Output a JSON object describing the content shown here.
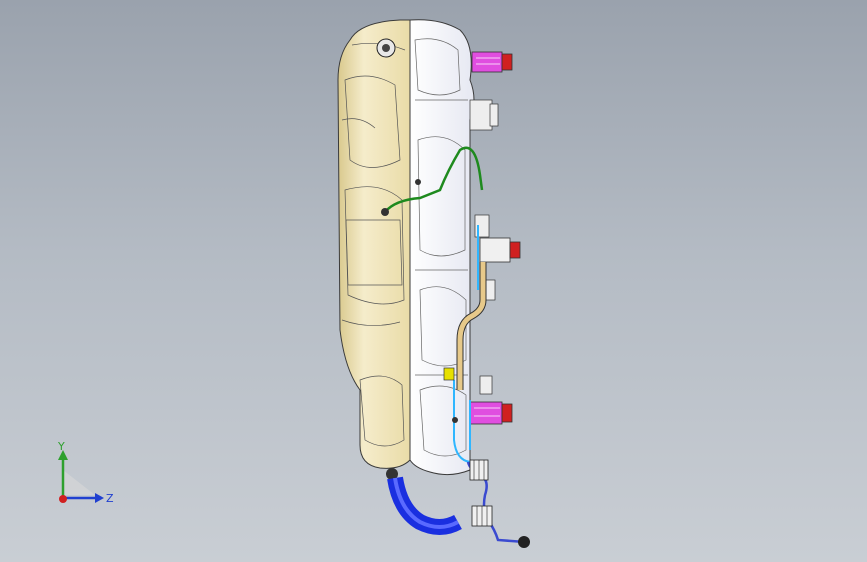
{
  "viewport": {
    "background_top": "#9aa2ad",
    "background_bottom": "#c9ced4"
  },
  "model": {
    "tank_color": "#f1e6b4",
    "tank_edge_color": "#3a3a3a",
    "connector_magenta": "#e04ee0",
    "connector_red": "#d02020",
    "hose_blue": "#1a2fe0",
    "line_green": "#1e8a1e",
    "line_cyan": "#2fb6ff",
    "pipe_tan": "#e7c98a"
  },
  "triad": {
    "y_label": "Y",
    "z_label": "Z",
    "y_color": "#2ea02e",
    "z_color": "#2040d0",
    "origin_color": "#d02020"
  }
}
